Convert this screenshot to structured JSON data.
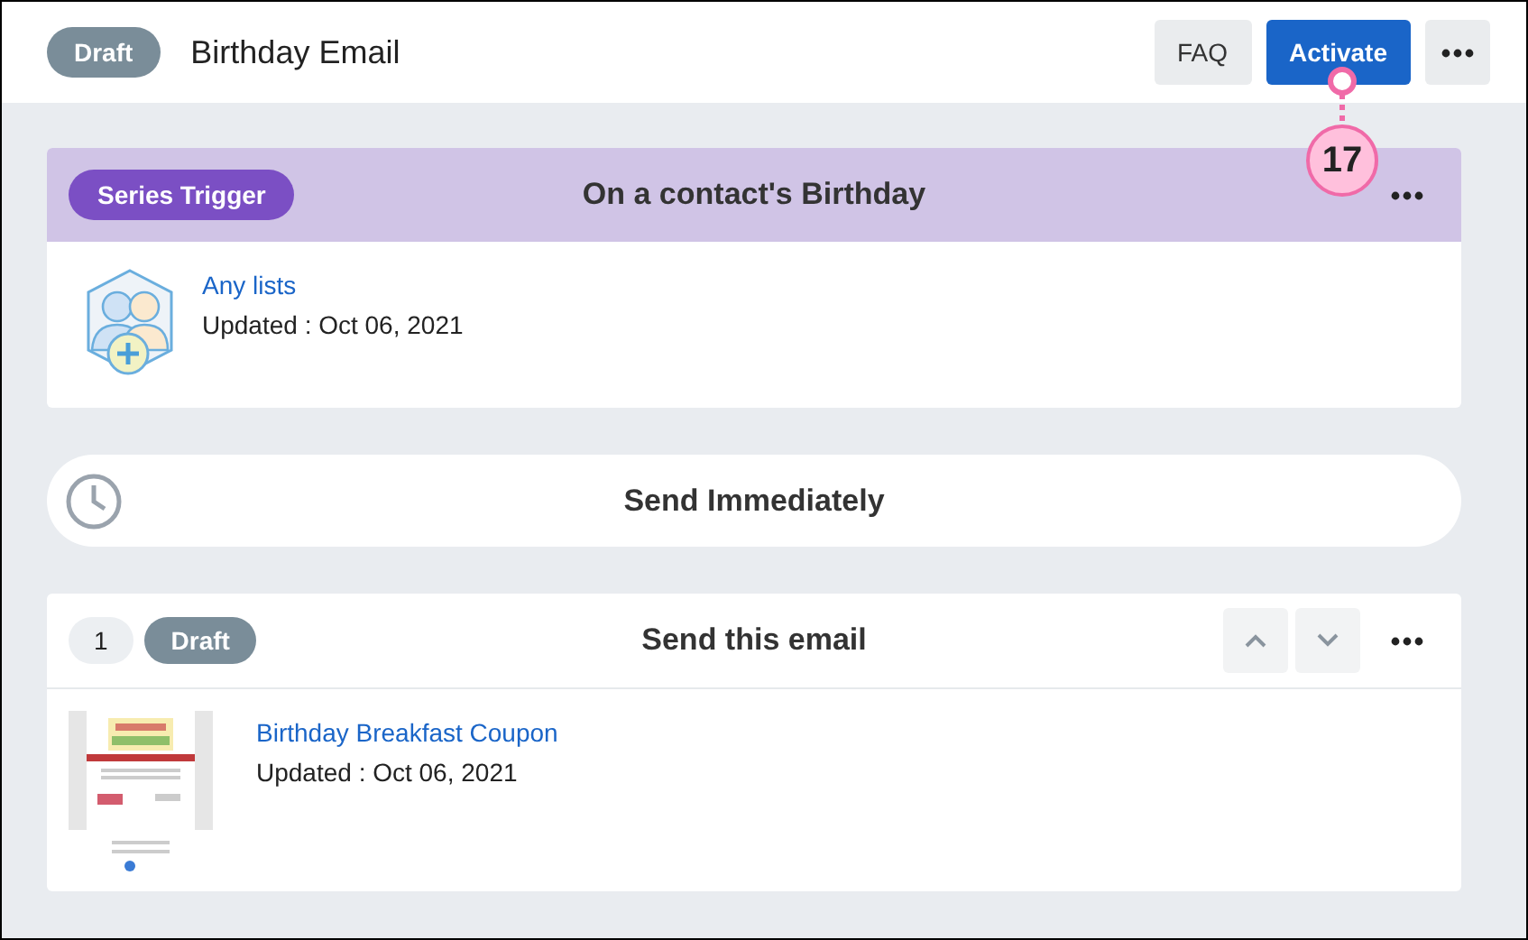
{
  "header": {
    "status": "Draft",
    "title": "Birthday Email",
    "buttons": [
      {
        "label": "FAQ",
        "kind": "secondary"
      },
      {
        "label": "Activate",
        "kind": "primary"
      }
    ]
  },
  "callout": {
    "number": "17"
  },
  "trigger": {
    "badge": "Series Trigger",
    "title": "On a contact's Birthday",
    "link": "Any lists",
    "updated": "Updated : Oct 06, 2021"
  },
  "delay": {
    "title": "Send Immediately"
  },
  "email_step": {
    "index": "1",
    "status": "Draft",
    "title": "Send this email",
    "link": "Birthday Breakfast Coupon",
    "updated": "Updated : Oct 06, 2021"
  }
}
